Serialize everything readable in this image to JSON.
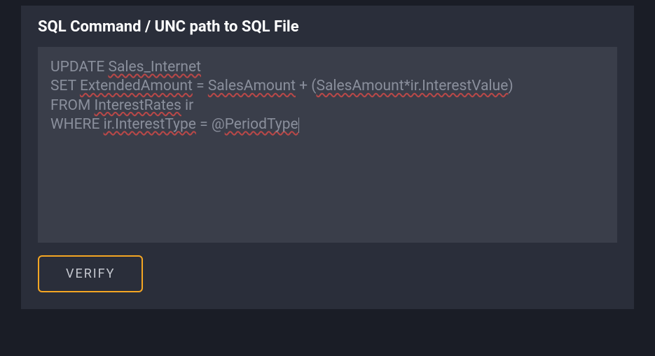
{
  "panel": {
    "title": "SQL Command / UNC path to SQL File"
  },
  "sql": {
    "line1_a": "UPDATE ",
    "line1_b": "Sales_Internet",
    "line2_a": "SET ",
    "line2_b": "ExtendedAmount",
    "line2_c": " = ",
    "line2_d": "SalesAmount",
    "line2_e": " + (",
    "line2_f": "SalesAmount*ir.InterestValue",
    "line2_g": ")",
    "line3_a": "FROM ",
    "line3_b": "InterestRates",
    "line3_c": " ir",
    "line4_a": "WHERE ",
    "line4_b": "ir.InterestType",
    "line4_c": " = @",
    "line4_d": "PeriodType"
  },
  "actions": {
    "verify_label": "VERIFY"
  }
}
